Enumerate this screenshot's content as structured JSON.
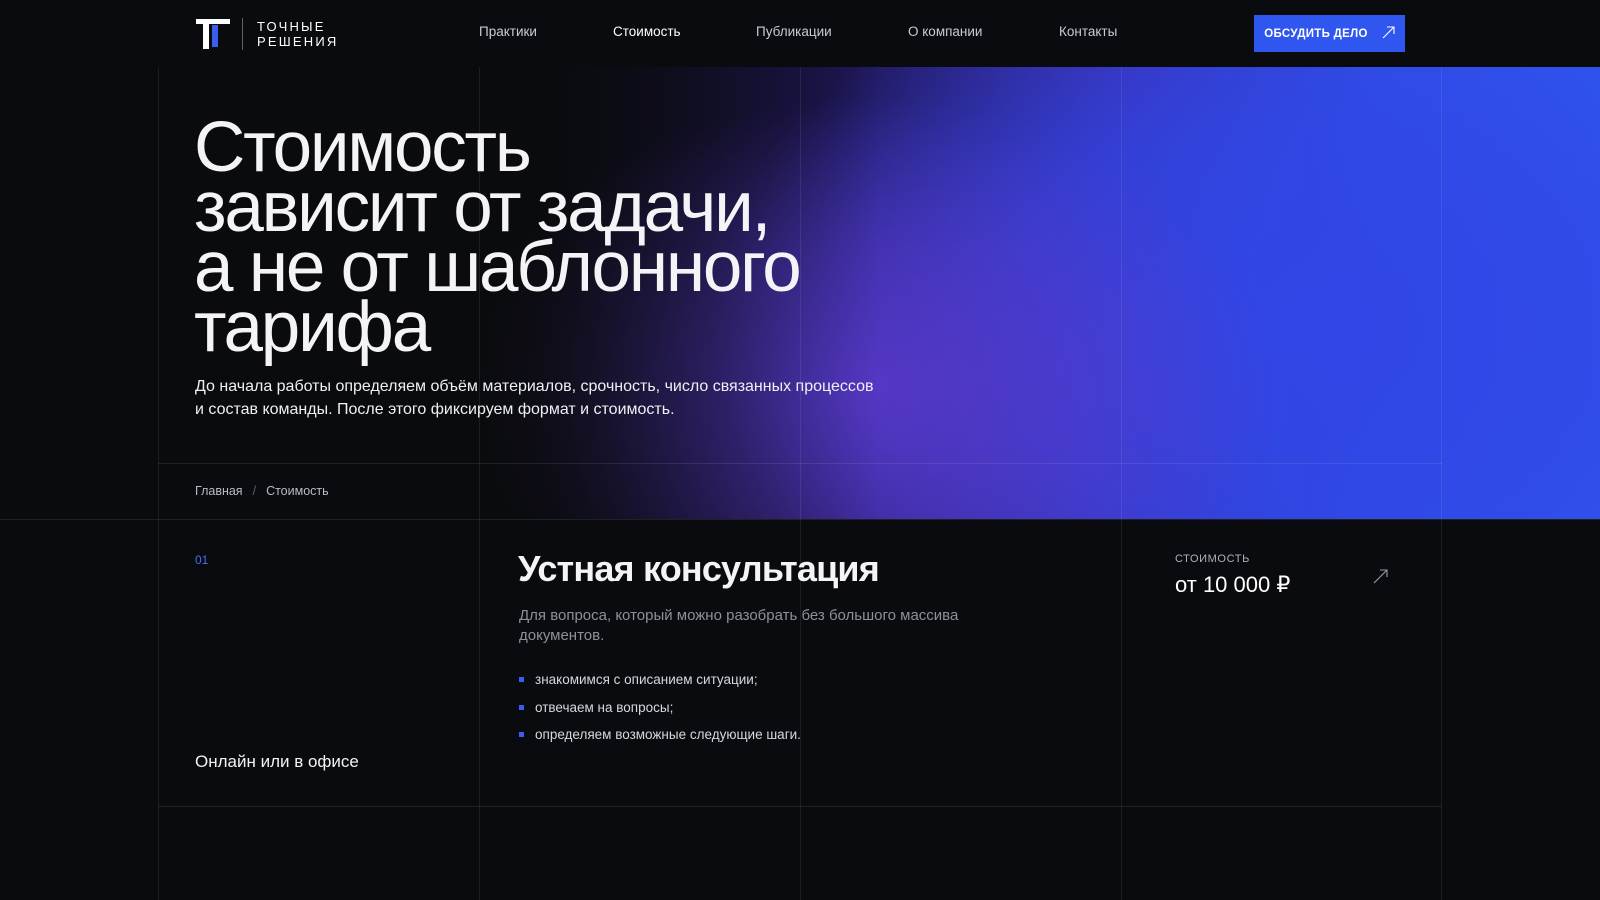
{
  "brand": {
    "name_line1": "ТОЧНЫЕ",
    "name_line2": "РЕШЕНИЯ",
    "accent_color": "#2f57ef"
  },
  "nav": {
    "items": [
      {
        "label": "Практики",
        "active": false
      },
      {
        "label": "Стоимость",
        "active": true
      },
      {
        "label": "Публикации",
        "active": false
      },
      {
        "label": "О компании",
        "active": false
      },
      {
        "label": "Контакты",
        "active": false
      }
    ],
    "cta_label": "ОБСУДИТЬ ДЕЛО",
    "cta_icon": "arrow-up-right-icon"
  },
  "hero": {
    "title_lines": [
      "Стоимость",
      "зависит от задачи,",
      "а не от шаблонного",
      "тарифа"
    ],
    "subtitle": "До начала работы определяем объём материалов, срочность, число связанных процессов и состав команды. После этого фиксируем формат и стоимость."
  },
  "breadcrumb": {
    "items": [
      "Главная",
      "Стоимость"
    ],
    "separator": "/"
  },
  "services": [
    {
      "number": "01",
      "title": "Устная консультация",
      "description": "Для вопроса, который можно разобрать без большого массива документов.",
      "steps": [
        "знакомимся с описанием ситуации;",
        "отвечаем на вопросы;",
        "определяем возможные следующие шаги."
      ],
      "format": "Онлайн или в офисе",
      "price_label": "стоимость",
      "price_value": "от 10 000 ₽",
      "arrow_icon": "arrow-up-right-icon"
    }
  ]
}
